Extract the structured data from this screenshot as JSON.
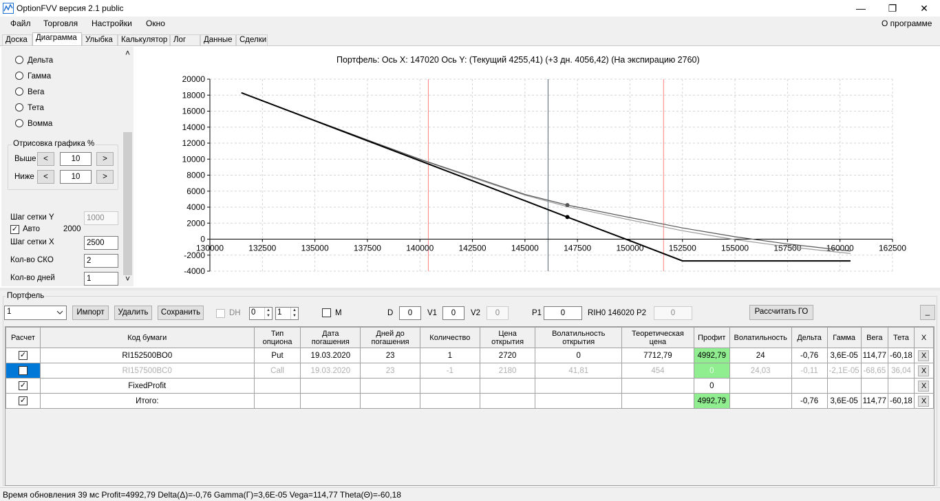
{
  "window": {
    "title": "OptionFVV версия 2.1 public",
    "minimize": "—",
    "maximize": "❐",
    "close": "✕"
  },
  "menu": {
    "file": "Файл",
    "trade": "Торговля",
    "settings": "Настройки",
    "window": "Окно",
    "about": "О программе"
  },
  "tabs": [
    "Доска",
    "Диаграмма",
    "Улыбка",
    "Калькулятор",
    "Лог",
    "Данные",
    "Сделки"
  ],
  "left_panel": {
    "radios": [
      "Дельта",
      "Гамма",
      "Вега",
      "Тета",
      "Вомма"
    ],
    "draw_group_title": "Отрисовка графика %",
    "above_label": "Выше",
    "above_value": "10",
    "below_label": "Ниже",
    "below_value": "10",
    "dec_label": "<",
    "inc_label": ">",
    "grid_y_label": "Шаг сетки Y",
    "grid_y_value": "1000",
    "auto_label": "Авто",
    "auto_value": "2000",
    "grid_x_label": "Шаг сетки X",
    "grid_x_value": "2500",
    "sko_label": "Кол-во СКО",
    "sko_value": "2",
    "days_label": "Кол-во дней",
    "days_value": "1",
    "scroll_up": "˄",
    "scroll_down": "˅"
  },
  "chart_title": "Портфель: Ось X: 147020 Ось Y:  (Текущий 4255,41)  (+3 дн. 4056,42)  (На экспирацию 2760)",
  "chart_data": {
    "type": "line",
    "title": "Портфель: Ось X: 147020 Ось Y:  (Текущий 4255,41)  (+3 дн. 4056,42)  (На экспирацию 2760)",
    "xlim": [
      130000,
      162500
    ],
    "ylim": [
      -4000,
      20000
    ],
    "x_ticks": [
      130000,
      132500,
      135000,
      137500,
      140000,
      142500,
      145000,
      147500,
      150000,
      152500,
      155000,
      157500,
      160000,
      162500
    ],
    "y_ticks": [
      -4000,
      -2000,
      0,
      2000,
      4000,
      6000,
      8000,
      10000,
      12000,
      14000,
      16000,
      18000,
      20000
    ],
    "grid": true,
    "vertical_lines": [
      {
        "x": 140400,
        "color": "#ff8080"
      },
      {
        "x": 146100,
        "color": "#556070"
      },
      {
        "x": 151600,
        "color": "#ff8080"
      }
    ],
    "series": [
      {
        "color": "#000000",
        "points": [
          [
            131500,
            18300
          ],
          [
            135000,
            14800
          ],
          [
            140000,
            9800
          ],
          [
            145000,
            4800
          ],
          [
            147020,
            2760
          ],
          [
            150000,
            -200
          ],
          [
            152500,
            -2720
          ],
          [
            160500,
            -2720
          ]
        ]
      },
      {
        "color": "#555555",
        "points": [
          [
            131500,
            18300
          ],
          [
            135000,
            14850
          ],
          [
            137500,
            12400
          ],
          [
            140000,
            10000
          ],
          [
            142500,
            7800
          ],
          [
            145000,
            5600
          ],
          [
            147020,
            4255
          ],
          [
            150000,
            2700
          ],
          [
            152500,
            1400
          ],
          [
            155000,
            300
          ],
          [
            157500,
            -600
          ],
          [
            160500,
            -1500
          ]
        ]
      },
      {
        "color": "#999999",
        "points": [
          [
            131500,
            18300
          ],
          [
            135000,
            14850
          ],
          [
            137500,
            12350
          ],
          [
            140000,
            9950
          ],
          [
            142500,
            7700
          ],
          [
            145000,
            5500
          ],
          [
            147020,
            4056
          ],
          [
            150000,
            2400
          ],
          [
            152500,
            1050
          ],
          [
            155000,
            -50
          ],
          [
            157500,
            -950
          ],
          [
            160500,
            -1800
          ]
        ]
      }
    ],
    "markers": [
      {
        "x": 147020,
        "y": 2760,
        "color": "#000000"
      },
      {
        "x": 147020,
        "y": 4255,
        "color": "#555555"
      }
    ]
  },
  "portfolio": {
    "title": "Портфель",
    "combo_value": "1",
    "import": "Импорт",
    "delete": "Удалить",
    "save": "Сохранить",
    "dh_label": "DH",
    "spin1": "0",
    "spin2": "1",
    "m_label": "M",
    "d_label": "D",
    "d_value": "0",
    "v1_label": "V1",
    "v1_value": "0",
    "v2_label": "V2",
    "v2_value": "0",
    "p1_label": "P1",
    "p1_value": "0",
    "rih_label": "RIH0 146020",
    "p2_label": "P2",
    "p2_value": "0",
    "calc_go": "Рассчитать ГО",
    "collapse": "_"
  },
  "grid": {
    "headers": [
      "Расчет",
      "Код бумаги",
      "Тип опциона",
      "Дата погашения",
      "Дней до погашения",
      "Количество",
      "Цена открытия",
      "Волатильность открытия",
      "Теоретическая цена",
      "Профит",
      "Волатильность",
      "Дельта",
      "Гамма",
      "Вега",
      "Тета",
      "X"
    ],
    "rows": [
      {
        "checked": "✓",
        "code": "RI152500BO0",
        "type": "Put",
        "date": "19.03.2020",
        "days": "23",
        "qty": "1",
        "open": "2720",
        "vol_open": "0",
        "theo": "7712,79",
        "profit": "4992,79",
        "vol": "24",
        "delta": "-0,76",
        "gamma": "3,6E-05",
        "vega": "114,77",
        "theta": "-60,18",
        "x": "X"
      },
      {
        "checked": "",
        "code": "RI157500BC0",
        "type": "Call",
        "date": "19.03.2020",
        "days": "23",
        "qty": "-1",
        "open": "2180",
        "vol_open": "41,81",
        "theo": "454",
        "profit": "0",
        "vol": "24,03",
        "delta": "-0,11",
        "gamma": "-2,1E-05",
        "vega": "-68,65",
        "theta": "36,04",
        "x": "X"
      },
      {
        "checked": "✓",
        "code": "FixedProfit",
        "type": "",
        "date": "",
        "days": "",
        "qty": "",
        "open": "",
        "vol_open": "",
        "theo": "",
        "profit": "0",
        "vol": "",
        "delta": "",
        "gamma": "",
        "vega": "",
        "theta": "",
        "x": "X"
      },
      {
        "checked": "✓",
        "code": "Итого:",
        "type": "",
        "date": "",
        "days": "",
        "qty": "",
        "open": "",
        "vol_open": "",
        "theo": "",
        "profit": "4992,79",
        "vol": "",
        "delta": "-0,76",
        "gamma": "3,6E-05",
        "vega": "114,77",
        "theta": "-60,18",
        "x": "X"
      }
    ]
  },
  "status": "Время обновления 39 мс  Profit=4992,79 Delta(Δ)=-0,76 Gamma(Γ)=3,6E-05 Vega=114,77 Theta(Θ)=-60,18"
}
